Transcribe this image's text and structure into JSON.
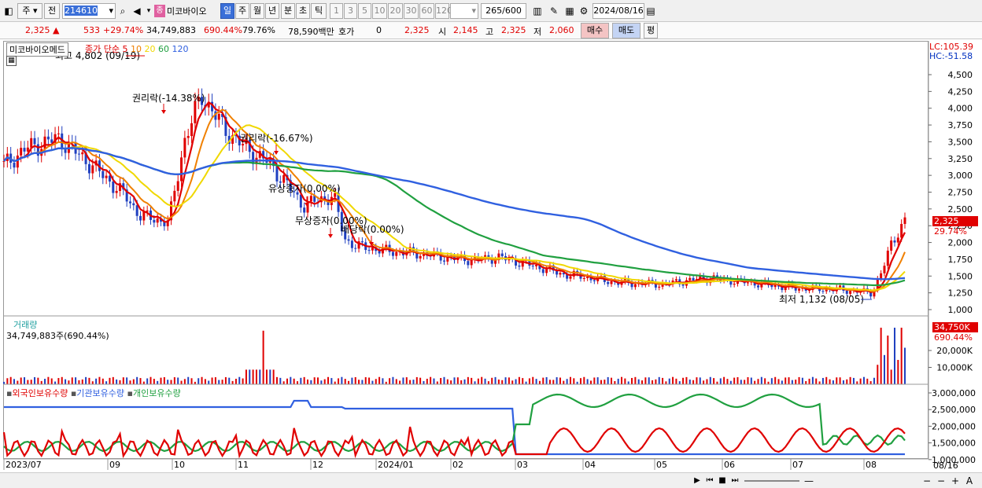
{
  "toolbar": {
    "market": "주",
    "prev": "전",
    "code": "214610",
    "stock_name": "미코바이오",
    "periods": [
      "일",
      "주",
      "월",
      "년",
      "분",
      "초",
      "틱"
    ],
    "minutes": [
      "1",
      "3",
      "5",
      "10",
      "20",
      "30",
      "60",
      "120"
    ],
    "count": "265",
    "count_total": "/600",
    "date": "2024/08/16"
  },
  "quote": {
    "price": "2,325",
    "change": "533",
    "change_pct": "+29.74%",
    "volume": "34,749,883",
    "vol_pct": "690.44%",
    "turnover": "79.76%",
    "amount": "78,590백만",
    "hoga_label": "호가",
    "hoga": "0",
    "hoga_price": "2,325",
    "open_label": "시",
    "open": "2,145",
    "high_label": "고",
    "high": "2,325",
    "low_label": "저",
    "low": "2,060",
    "buy": "매수",
    "sell": "매도",
    "avg": "평"
  },
  "price_panel": {
    "legend_name": "미코바이오메드",
    "legend_type": "종가 단순",
    "ma": [
      {
        "label": "5",
        "color": "#e00000"
      },
      {
        "label": "10",
        "color": "#f08000"
      },
      {
        "label": "20",
        "color": "#f0d800"
      },
      {
        "label": "60",
        "color": "#20a040"
      },
      {
        "label": "120",
        "color": "#3060e0"
      }
    ],
    "lc": "LC:105.39",
    "hc": "HC:-51.58",
    "y_ticks": [
      "4,500",
      "4,250",
      "4,000",
      "3,750",
      "3,500",
      "3,250",
      "3,000",
      "2,750",
      "2,500",
      "2,250",
      "2,000",
      "1,750",
      "1,500",
      "1,250",
      "1,000"
    ],
    "cur_price": "2,325",
    "cur_pct": "29.74%",
    "high_mark": "최고 4,802 (09/19)",
    "low_mark": "최저 1,132 (08/05)",
    "events": [
      "권리락(-14.38%)",
      "권리락(-16.67%)",
      "유상증자(0.00%)",
      "무상증자(0.00%)",
      "배당락(0.00%)"
    ]
  },
  "volume_panel": {
    "title": "거래량",
    "value": "34,749,883주(690.44%)",
    "cur": "34,750K",
    "cur_pct": "690.44%",
    "y_ticks": [
      "20,000K",
      "10,000K"
    ]
  },
  "holder_panel": {
    "legends": [
      "외국인보유수량",
      "기관보유수량",
      "개인보유수량"
    ],
    "y_ticks": [
      "3,000,000",
      "2,500,000",
      "2,000,000",
      "1,500,000",
      "1,000,000"
    ]
  },
  "x_axis": [
    "2023/07",
    "09",
    "10",
    "11",
    "12",
    "2024/01",
    "02",
    "03",
    "04",
    "05",
    "06",
    "07",
    "08"
  ],
  "x_end": "08/16",
  "colors": {
    "red": "#e00000",
    "blue": "#3060e0",
    "green": "#20a040",
    "yellow": "#f0d800",
    "orange": "#f08000"
  }
}
